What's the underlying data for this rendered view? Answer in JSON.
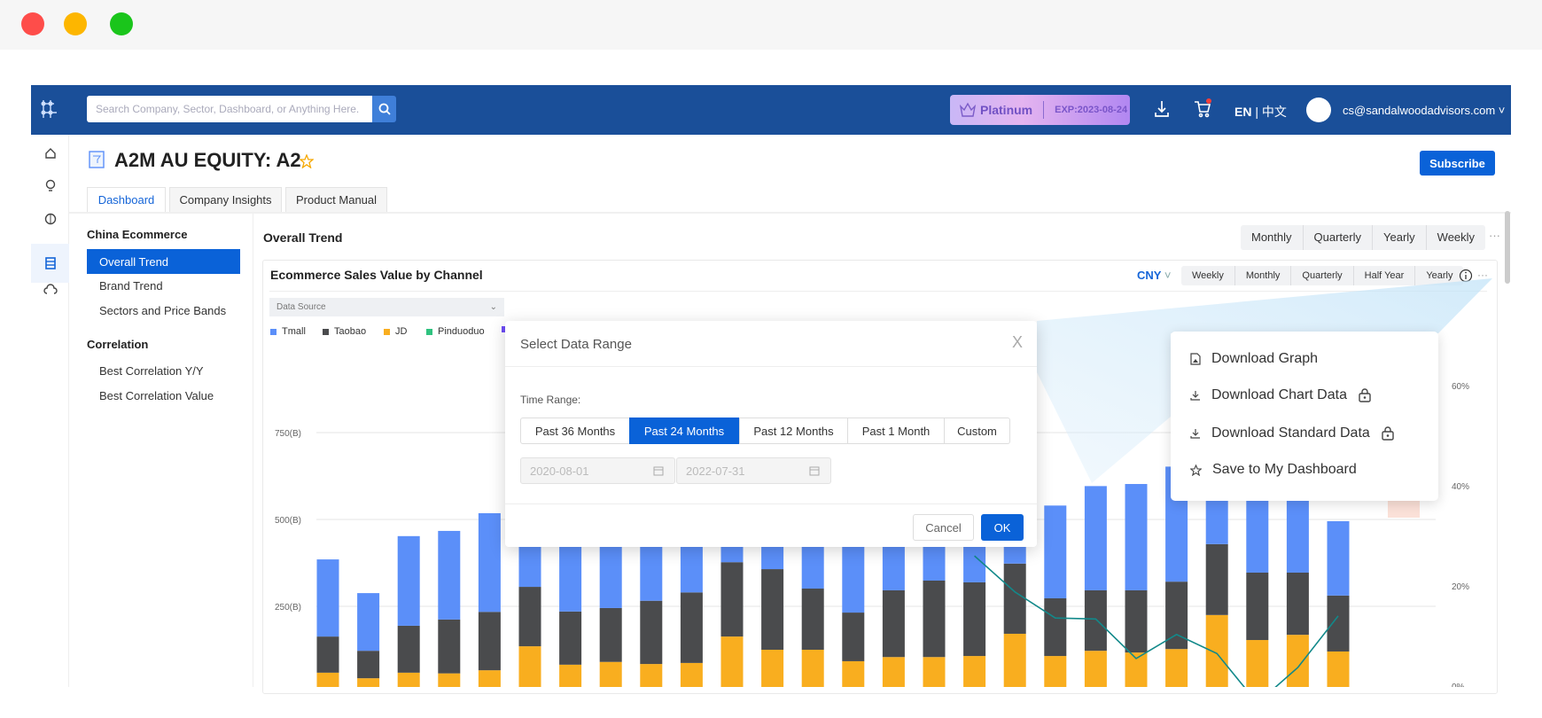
{
  "window": {
    "controls": [
      {
        "name": "close",
        "color": "#fe4d4a"
      },
      {
        "name": "minimize",
        "color": "#fdb600"
      },
      {
        "name": "maximize",
        "color": "#1ac51b"
      }
    ]
  },
  "header": {
    "search_placeholder": "Search Company, Sector, Dashboard, or Anything Here.",
    "plan": "Platinum",
    "expiry": "EXP:2023-08-24",
    "lang_en": "EN",
    "lang_sep": "|",
    "lang_cn": "中文",
    "user_email": "cs@sandalwoodadvisors.com"
  },
  "page": {
    "title": "A2M AU EQUITY: A2",
    "subscribe": "Subscribe",
    "tabs": [
      "Dashboard",
      "Company Insights",
      "Product Manual"
    ],
    "active_tab": "Dashboard"
  },
  "sidebar": {
    "groups": [
      {
        "title": "China Ecommerce",
        "items": [
          "Overall Trend",
          "Brand Trend",
          "Sectors and Price Bands"
        ]
      },
      {
        "title": "Correlation",
        "items": [
          "Best Correlation Y/Y",
          "Best Correlation Value"
        ]
      }
    ],
    "active": "Overall Trend"
  },
  "main": {
    "section_title": "Overall Trend",
    "periods": [
      "Monthly",
      "Quarterly",
      "Yearly",
      "Weekly"
    ]
  },
  "chart_card": {
    "title": "Ecommerce Sales Value by Channel",
    "currency": "CNY",
    "periods": [
      "Weekly",
      "Monthly",
      "Quarterly",
      "Half Year",
      "Yearly"
    ],
    "data_source_placeholder": "Data Source"
  },
  "dialog": {
    "title": "Select Data Range",
    "label": "Time Range:",
    "options": [
      "Past 36 Months",
      "Past 24 Months",
      "Past 12 Months",
      "Past 1 Month",
      "Custom"
    ],
    "selected": "Past 24 Months",
    "start_date": "2020-08-01",
    "end_date": "2022-07-31",
    "cancel": "Cancel",
    "ok": "OK"
  },
  "menu": {
    "items": [
      {
        "label": "Download Graph",
        "icon": "file-image-icon",
        "locked": false
      },
      {
        "label": "Download Chart Data",
        "icon": "download-icon",
        "locked": true
      },
      {
        "label": "Download Standard Data",
        "icon": "download-icon",
        "locked": true
      },
      {
        "label": "Save to My Dashboard",
        "icon": "star-icon",
        "locked": false
      }
    ]
  },
  "chart_data": {
    "type": "bar",
    "stacked": true,
    "legend": [
      {
        "name": "Tmall",
        "color": "#5b8ff9"
      },
      {
        "name": "Taobao",
        "color": "#4a4b4d"
      },
      {
        "name": "JD",
        "color": "#f9ae1f"
      },
      {
        "name": "Pinduoduo",
        "color": "#2fc27f"
      },
      {
        "name": "",
        "color": "#6d4cf6"
      }
    ],
    "y_left": {
      "ticks": [
        "250(B)",
        "500(B)",
        "750(B)"
      ],
      "range": [
        0,
        800
      ],
      "unit": "B"
    },
    "y_right": {
      "ticks": [
        "0%",
        "20%",
        "40%",
        "60%"
      ],
      "range": [
        0,
        65
      ]
    },
    "grid": true,
    "series": [
      {
        "name": "Pinduoduo",
        "color": "#2fc27f",
        "values": [
          0,
          0,
          0,
          0,
          0,
          0,
          0,
          0,
          0,
          0,
          3,
          8,
          3,
          0,
          0,
          0,
          2,
          4,
          2,
          6,
          4,
          12,
          16,
          16,
          14,
          8
        ]
      },
      {
        "name": "JD",
        "color": "#f9ae1f",
        "values": [
          59,
          43,
          59,
          57,
          66,
          135,
          82,
          90,
          84,
          87,
          160,
          117,
          122,
          92,
          104,
          104,
          105,
          167,
          105,
          116,
          113,
          115,
          209,
          137,
          154,
          112
        ]
      },
      {
        "name": "Taobao",
        "color": "#4a4b4d",
        "values": [
          104,
          79,
          135,
          155,
          168,
          171,
          153,
          155,
          182,
          203,
          214,
          232,
          176,
          140,
          192,
          220,
          212,
          202,
          166,
          174,
          179,
          194,
          204,
          194,
          179,
          161
        ]
      },
      {
        "name": "Tmall",
        "color": "#5b8ff9",
        "values": [
          222,
          166,
          258,
          255,
          284,
          234,
          285,
          290,
          284,
          270,
          63,
          73,
          170,
          238,
          184,
          156,
          171,
          57,
          267,
          300,
          306,
          331,
          231,
          293,
          273,
          214
        ]
      }
    ],
    "line": {
      "color": "#12898a",
      "axis": "right",
      "values": [
        null,
        null,
        null,
        null,
        null,
        null,
        null,
        null,
        null,
        null,
        null,
        null,
        null,
        null,
        null,
        null,
        26,
        18.8,
        13.6,
        13.4,
        5.5,
        10.3,
        6.5,
        -3.4,
        3.7,
        14
      ]
    }
  }
}
